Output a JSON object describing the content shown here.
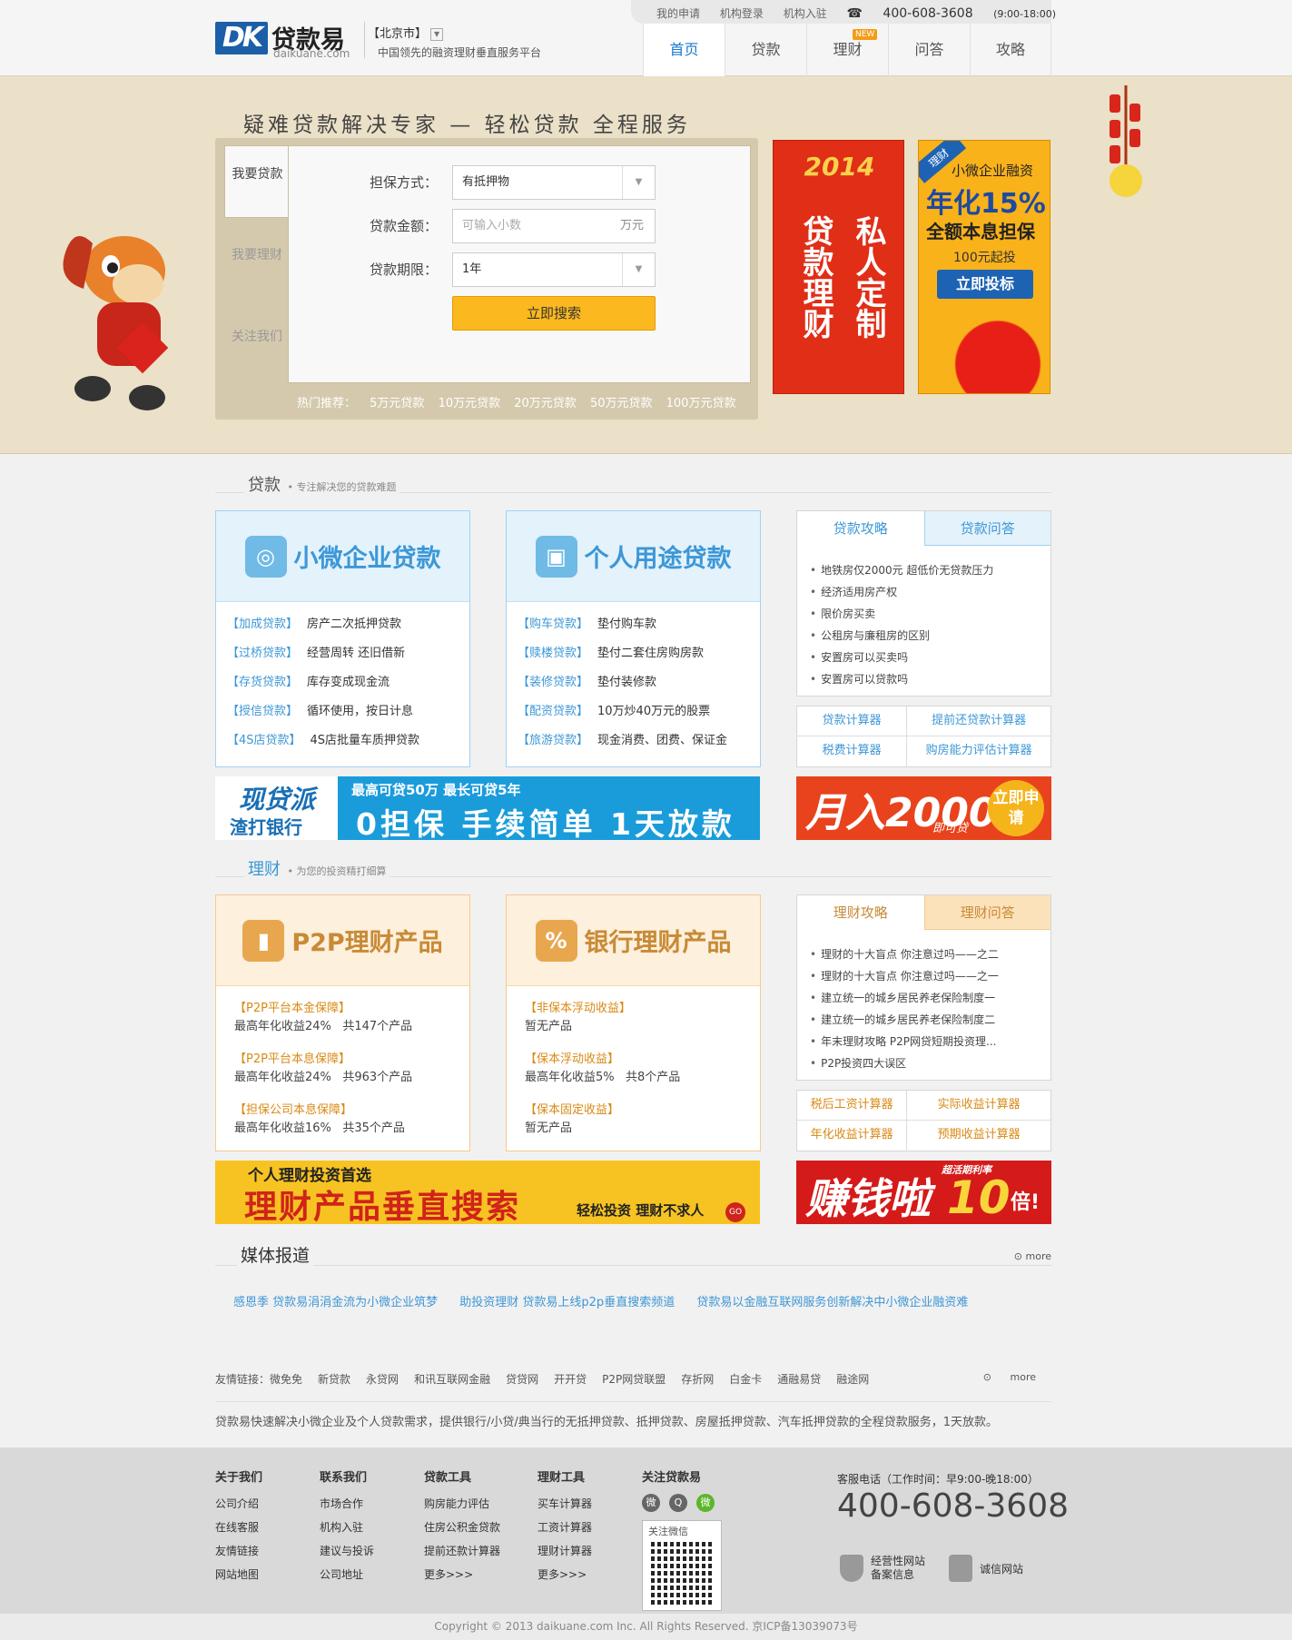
{
  "header": {
    "logo_cn": "贷款易",
    "logo_en": "daikuane.com",
    "city": "【北京市】",
    "slogan": "中国领先的融资理财垂直服务平台",
    "toplinks": [
      "我的申请",
      "机构登录",
      "机构入驻"
    ],
    "phone": "400-608-3608",
    "phone_hours": "(9:00-18:00)",
    "nav": [
      {
        "label": "首页",
        "active": true
      },
      {
        "label": "贷款"
      },
      {
        "label": "理财",
        "badge": "NEW"
      },
      {
        "label": "问答"
      },
      {
        "label": "攻略"
      }
    ]
  },
  "hero": {
    "tagline": "疑难贷款解决专家 — 轻松贷款 全程服务",
    "tabs": [
      "我要贷款",
      "我要理财",
      "关注我们"
    ],
    "form": {
      "guarantee_label": "担保方式：",
      "guarantee_value": "有抵押物",
      "amount_label": "贷款金额：",
      "amount_placeholder": "可输入小数",
      "amount_unit": "万元",
      "term_label": "贷款期限：",
      "term_value": "1年",
      "submit": "立即搜索"
    },
    "hot_label": "热门推荐：",
    "hot": [
      "5万元贷款",
      "10万元贷款",
      "20万元贷款",
      "50万元贷款",
      "100万元贷款"
    ],
    "ad1": {
      "year": "2014",
      "col1": "贷款理财",
      "col2": "私人定制"
    },
    "ad2": {
      "badge": "理财",
      "t1": "小微企业融资",
      "t2": "年化15%",
      "t3": "全额本息担保",
      "t4": "100元起投",
      "btn": "立即投标"
    },
    "icons": {
      "horse": "horse-mascot-icon",
      "firecracker": "firecracker-icon"
    }
  },
  "loan": {
    "title": "贷款",
    "subtitle": "专注解决您的贷款难题",
    "card1": {
      "title": "小微企业贷款",
      "items": [
        [
          "【加成贷款】",
          "房产二次抵押贷款"
        ],
        [
          "【过桥贷款】",
          "经营周转 还旧借新"
        ],
        [
          "【存货贷款】",
          "库存变成现金流"
        ],
        [
          "【授信贷款】",
          "循环使用，按日计息"
        ],
        [
          "【4S店贷款】",
          "4S店批量车质押贷款"
        ]
      ]
    },
    "card2": {
      "title": "个人用途贷款",
      "items": [
        [
          "【购车贷款】",
          "垫付购车款"
        ],
        [
          "【赎楼贷款】",
          "垫付二套住房购房款"
        ],
        [
          "【装修贷款】",
          "垫付装修款"
        ],
        [
          "【配资贷款】",
          "10万炒40万元的股票"
        ],
        [
          "【旅游贷款】",
          "现金消费、团费、保证金"
        ]
      ]
    },
    "tabs": [
      "贷款攻略",
      "贷款问答"
    ],
    "articles": [
      "地铁房仅2000元 超低价无贷款压力",
      "经济适用房产权",
      "限价房买卖",
      "公租房与廉租房的区别",
      "安置房可以买卖吗",
      "安置房可以贷款吗"
    ],
    "tools": [
      "贷款计算器",
      "提前还贷款计算器",
      "税费计算器",
      "购房能力评估计算器"
    ],
    "banner_a": {
      "brand": "现贷派",
      "bank": "渣打银行",
      "sub": "最高可贷50万 最长可贷5年",
      "main": "0担保 手续简单 1天放款"
    },
    "banner_b": {
      "main": "月入2000",
      "sub": "即可贷",
      "btn": "立即申请"
    }
  },
  "finance": {
    "title": "理财",
    "subtitle": "为您的投资精打细算",
    "card1": {
      "title": "P2P理财产品",
      "items": [
        [
          "【P2P平台本金保障】",
          "最高年化收益24%",
          "共147个产品"
        ],
        [
          "【P2P平台本息保障】",
          "最高年化收益24%",
          "共963个产品"
        ],
        [
          "【担保公司本息保障】",
          "最高年化收益16%",
          "共35个产品"
        ]
      ]
    },
    "card2": {
      "title": "银行理财产品",
      "items": [
        [
          "【非保本浮动收益】",
          "暂无产品",
          ""
        ],
        [
          "【保本浮动收益】",
          "最高年化收益5%",
          "共8个产品"
        ],
        [
          "【保本固定收益】",
          "暂无产品",
          ""
        ]
      ]
    },
    "tabs": [
      "理财攻略",
      "理财问答"
    ],
    "articles": [
      "理财的十大盲点 你注意过吗——之二",
      "理财的十大盲点 你注意过吗——之一",
      "建立统一的城乡居民养老保险制度一",
      "建立统一的城乡居民养老保险制度二",
      "年末理财攻略 P2P网贷短期投资理...",
      "P2P投资四大误区"
    ],
    "tools": [
      "税后工资计算器",
      "实际收益计算器",
      "年化收益计算器",
      "预期收益计算器"
    ],
    "banner_c": {
      "a": "个人理财投资首选",
      "b": "理财产品垂直搜索",
      "c": "轻松投资 理财不求人",
      "go": "GO"
    },
    "banner_d": {
      "a": "赚钱啦",
      "b": "超活期利率",
      "c": "10",
      "d": "倍!"
    }
  },
  "media": {
    "title": "媒体报道",
    "more": "more",
    "items": [
      "感恩季 贷款易涓涓金流为小微企业筑梦",
      "助投资理财 贷款易上线p2p垂直搜索频道",
      "贷款易以金融互联网服务创新解决中小微企业融资难"
    ]
  },
  "friends": {
    "label": "友情链接：",
    "items": [
      "微免免",
      "新贷款",
      "永贷网",
      "和讯互联网金融",
      "贷贷网",
      "开开贷",
      "P2P网贷联盟",
      "存折网",
      "白金卡",
      "通融易贷",
      "融途网"
    ],
    "more": "more"
  },
  "desc": "贷款易快速解决小微企业及个人贷款需求，提供银行/小贷/典当行的无抵押贷款、抵押贷款、房屋抵押贷款、汽车抵押贷款的全程贷款服务，1天放款。",
  "footer": {
    "cols": [
      {
        "title": "关于我们",
        "items": [
          "公司介绍",
          "在线客服",
          "友情链接",
          "网站地图"
        ]
      },
      {
        "title": "联系我们",
        "items": [
          "市场合作",
          "机构入驻",
          "建议与投诉",
          "公司地址"
        ]
      },
      {
        "title": "贷款工具",
        "items": [
          "购房能力评估",
          "住房公积金贷款",
          "提前还款计算器",
          "更多>>>"
        ]
      },
      {
        "title": "理财工具",
        "items": [
          "买车计算器",
          "工资计算器",
          "理财计算器",
          "更多>>>"
        ]
      }
    ],
    "social_title": "关注贷款易",
    "qr_label": "关注微信",
    "hotline_label": "客服电话（工作时间：早9:00-晚18:00）",
    "hotline": "400-608-3608",
    "cert1": "经营性网站备案信息",
    "cert2": "诚信网站",
    "copyright": "Copyright © 2013 daikuane.com Inc. All Rights Reserved. 京ICP备13039073号"
  }
}
